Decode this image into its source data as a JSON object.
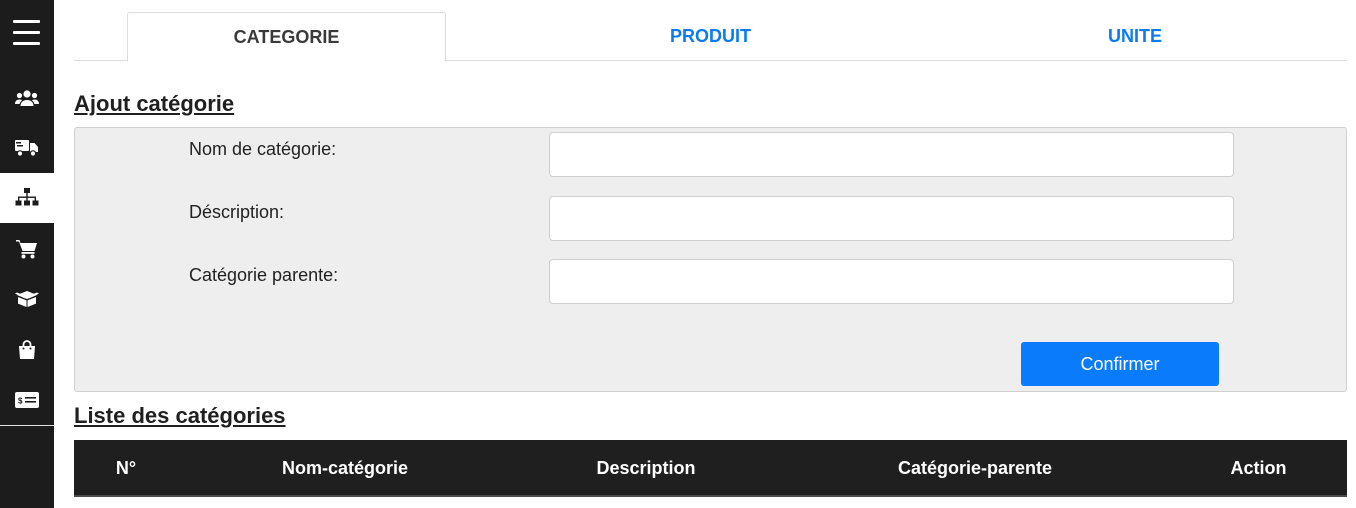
{
  "sidebar": {
    "menu_icon": "hamburger-menu-icon",
    "items": [
      {
        "icon": "users-icon",
        "active": false
      },
      {
        "icon": "truck-icon",
        "active": false
      },
      {
        "icon": "sitemap-icon",
        "active": true
      },
      {
        "icon": "cart-icon",
        "active": false
      },
      {
        "icon": "box-icon",
        "active": false
      },
      {
        "icon": "shopping-bag-icon",
        "active": false
      },
      {
        "icon": "money-check-icon",
        "active": false
      }
    ]
  },
  "tabs": [
    {
      "label": "CATEGORIE",
      "active": true
    },
    {
      "label": "PRODUIT",
      "active": false
    },
    {
      "label": "UNITE",
      "active": false
    }
  ],
  "form": {
    "title": "Ajout catégorie",
    "fields": [
      {
        "label": "Nom de catégorie:",
        "value": "",
        "placeholder": ""
      },
      {
        "label": "Déscription:",
        "value": "",
        "placeholder": ""
      },
      {
        "label": "Catégorie parente:",
        "value": "",
        "placeholder": ""
      }
    ],
    "submit_label": "Confirmer"
  },
  "list": {
    "title": "Liste des catégories",
    "columns": [
      "N°",
      "Nom-catégorie",
      "Description",
      "Catégorie-parente",
      "Action"
    ]
  },
  "colors": {
    "sidebar_bg": "#1c1c1c",
    "accent": "#0a7bfb",
    "tab_link": "#0a7bf2",
    "panel_bg": "#eeeeee",
    "table_header_bg": "#1f1f1f"
  }
}
